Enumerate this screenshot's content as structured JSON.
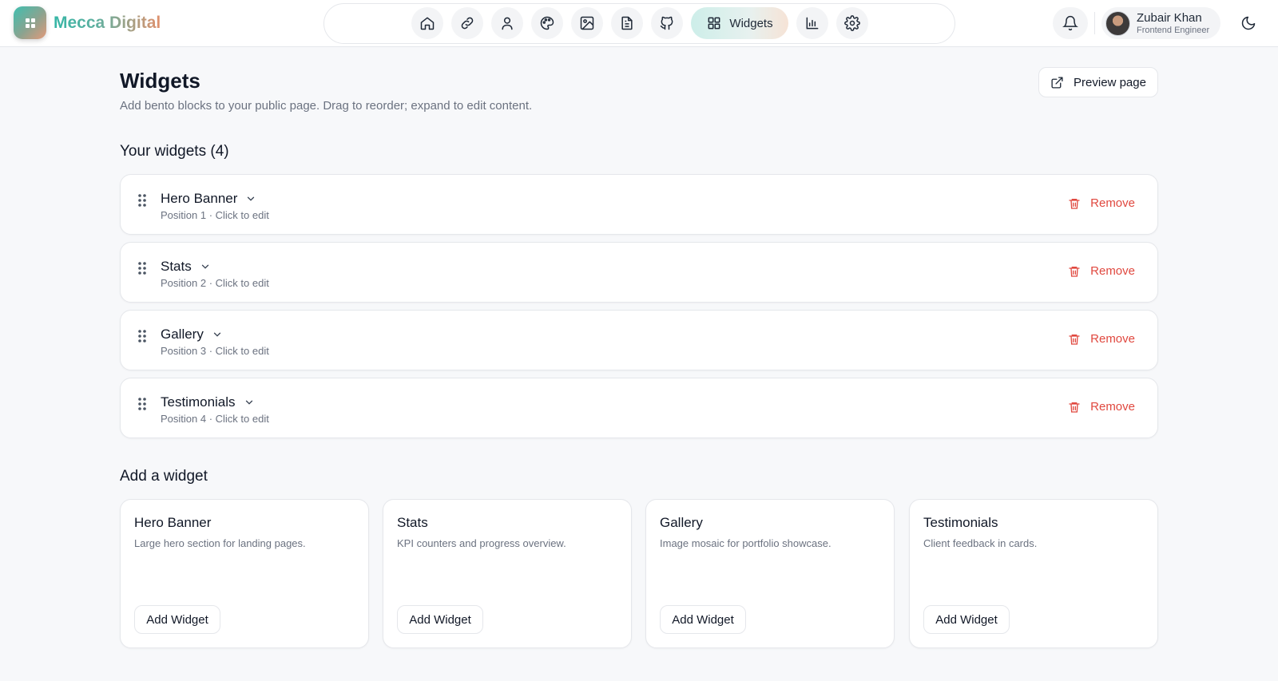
{
  "app": {
    "name": "Mecca Digital"
  },
  "nav": {
    "icons": [
      "home-icon",
      "link-icon",
      "user-icon",
      "palette-icon",
      "image-icon",
      "document-icon",
      "github-icon"
    ],
    "active_label": "Widgets",
    "after_icons": [
      "bar-chart-icon",
      "gear-icon"
    ]
  },
  "user": {
    "name": "Zubair Khan",
    "role": "Frontend Engineer"
  },
  "page": {
    "title": "Widgets",
    "subtitle": "Add bento blocks to your public page. Drag to reorder; expand to edit content.",
    "preview_label": "Preview page"
  },
  "your_widgets": {
    "heading": "Your widgets (4)",
    "items": [
      {
        "title": "Hero Banner",
        "subtitle": "Position 1 · Click to edit",
        "remove_label": "Remove"
      },
      {
        "title": "Stats",
        "subtitle": "Position 2 · Click to edit",
        "remove_label": "Remove"
      },
      {
        "title": "Gallery",
        "subtitle": "Position 3 · Click to edit",
        "remove_label": "Remove"
      },
      {
        "title": "Testimonials",
        "subtitle": "Position 4 · Click to edit",
        "remove_label": "Remove"
      }
    ]
  },
  "add_widget": {
    "heading": "Add a widget",
    "cards": [
      {
        "title": "Hero Banner",
        "desc": "Large hero section for landing pages.",
        "button": "Add Widget"
      },
      {
        "title": "Stats",
        "desc": "KPI counters and progress overview.",
        "button": "Add Widget"
      },
      {
        "title": "Gallery",
        "desc": "Image mosaic for portfolio showcase.",
        "button": "Add Widget"
      },
      {
        "title": "Testimonials",
        "desc": "Client feedback in cards.",
        "button": "Add Widget"
      }
    ]
  },
  "colors": {
    "accent": "#3fbfb0",
    "danger": "#e0483f",
    "background": "#f7f8fa"
  }
}
